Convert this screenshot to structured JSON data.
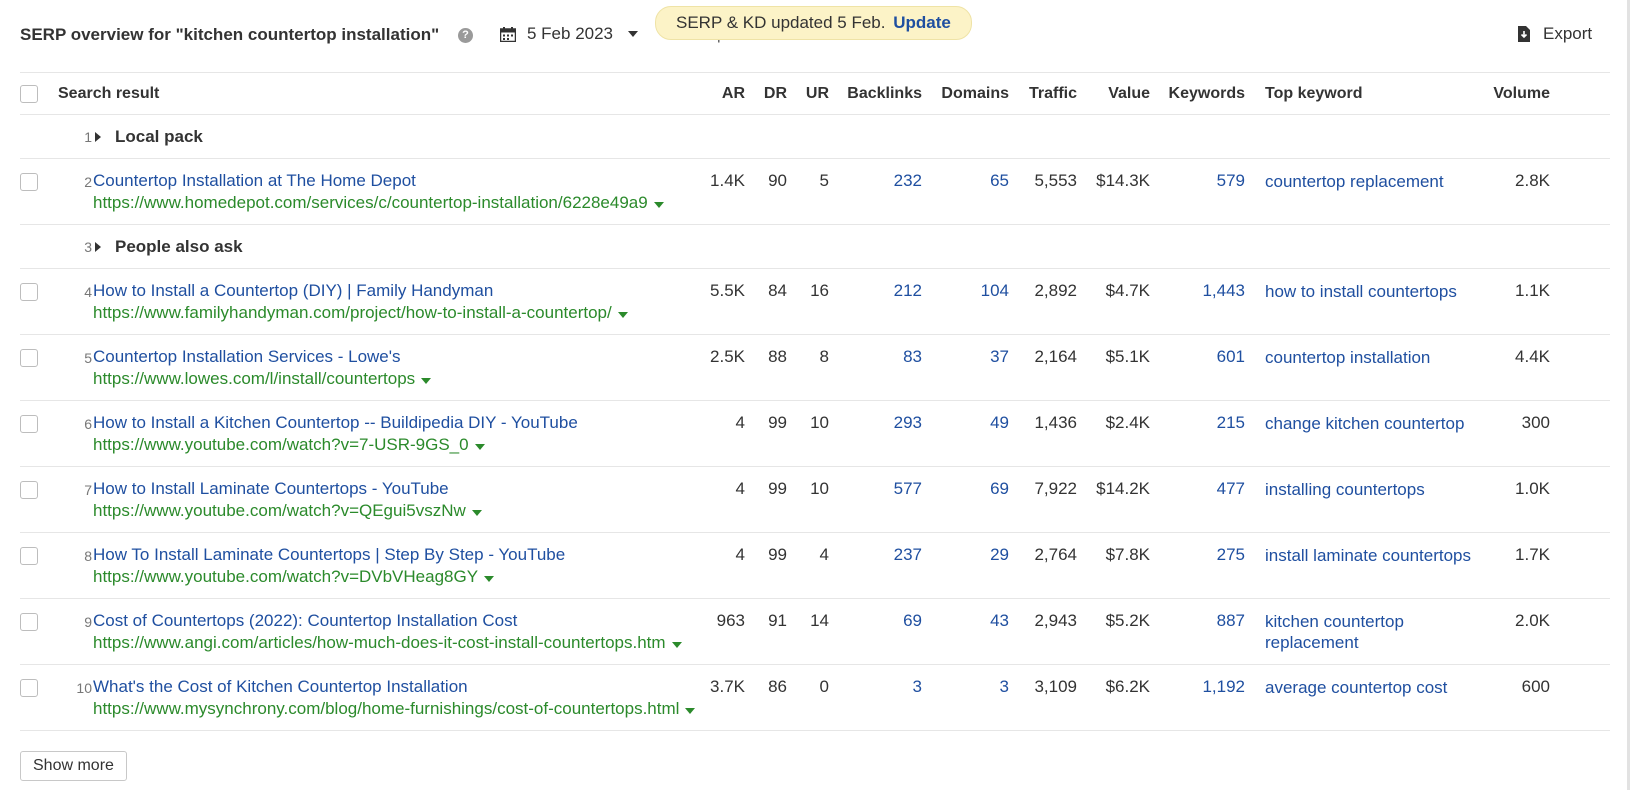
{
  "header": {
    "title": "SERP overview for \"kitchen countertop installation\"",
    "help_icon": "?",
    "date": "5 Feb 2023",
    "compare_label": "Compare with",
    "toast_text": "SERP & KD updated 5 Feb.",
    "toast_link": "Update",
    "export_label": "Export"
  },
  "columns": {
    "search_result": "Search result",
    "ar": "AR",
    "dr": "DR",
    "ur": "UR",
    "backlinks": "Backlinks",
    "domains": "Domains",
    "traffic": "Traffic",
    "value": "Value",
    "keywords": "Keywords",
    "top_keyword": "Top keyword",
    "volume": "Volume"
  },
  "features": [
    {
      "position": "1",
      "label": "Local pack"
    },
    {
      "position": "3",
      "label": "People also ask"
    }
  ],
  "results": [
    {
      "position": "2",
      "title": "Countertop Installation at The Home Depot",
      "url": "https://www.homedepot.com/services/c/countertop-installation/6228e49a9",
      "ar": "1.4K",
      "dr": "90",
      "ur": "5",
      "backlinks": "232",
      "domains": "65",
      "traffic": "5,553",
      "value": "$14.3K",
      "keywords": "579",
      "top_keyword": "countertop replacement",
      "volume": "2.8K"
    },
    {
      "position": "4",
      "title": "How to Install a Countertop (DIY) | Family Handyman",
      "url": "https://www.familyhandyman.com/project/how-to-install-a-countertop/",
      "ar": "5.5K",
      "dr": "84",
      "ur": "16",
      "backlinks": "212",
      "domains": "104",
      "traffic": "2,892",
      "value": "$4.7K",
      "keywords": "1,443",
      "top_keyword": "how to install countertops",
      "volume": "1.1K"
    },
    {
      "position": "5",
      "title": "Countertop Installation Services - Lowe's",
      "url": "https://www.lowes.com/l/install/countertops",
      "ar": "2.5K",
      "dr": "88",
      "ur": "8",
      "backlinks": "83",
      "domains": "37",
      "traffic": "2,164",
      "value": "$5.1K",
      "keywords": "601",
      "top_keyword": "countertop installation",
      "volume": "4.4K"
    },
    {
      "position": "6",
      "title": "How to Install a Kitchen Countertop -- Buildipedia DIY - YouTube",
      "url": "https://www.youtube.com/watch?v=7-USR-9GS_0",
      "ar": "4",
      "dr": "99",
      "ur": "10",
      "backlinks": "293",
      "domains": "49",
      "traffic": "1,436",
      "value": "$2.4K",
      "keywords": "215",
      "top_keyword": "change kitchen countertop",
      "volume": "300"
    },
    {
      "position": "7",
      "title": "How to Install Laminate Countertops - YouTube",
      "url": "https://www.youtube.com/watch?v=QEgui5vszNw",
      "ar": "4",
      "dr": "99",
      "ur": "10",
      "backlinks": "577",
      "domains": "69",
      "traffic": "7,922",
      "value": "$14.2K",
      "keywords": "477",
      "top_keyword": "installing countertops",
      "volume": "1.0K"
    },
    {
      "position": "8",
      "title": "How To Install Laminate Countertops | Step By Step - YouTube",
      "url": "https://www.youtube.com/watch?v=DVbVHeag8GY",
      "ar": "4",
      "dr": "99",
      "ur": "4",
      "backlinks": "237",
      "domains": "29",
      "traffic": "2,764",
      "value": "$7.8K",
      "keywords": "275",
      "top_keyword": "install laminate countertops",
      "volume": "1.7K"
    },
    {
      "position": "9",
      "title": "Cost of Countertops (2022): Countertop Installation Cost",
      "url": "https://www.angi.com/articles/how-much-does-it-cost-install-countertops.htm",
      "ar": "963",
      "dr": "91",
      "ur": "14",
      "backlinks": "69",
      "domains": "43",
      "traffic": "2,943",
      "value": "$5.2K",
      "keywords": "887",
      "top_keyword": "kitchen countertop replacement",
      "volume": "2.0K"
    },
    {
      "position": "10",
      "title": "What's the Cost of Kitchen Countertop Installation",
      "url": "https://www.mysynchrony.com/blog/home-furnishings/cost-of-countertops.html",
      "ar": "3.7K",
      "dr": "86",
      "ur": "0",
      "backlinks": "3",
      "domains": "3",
      "traffic": "3,109",
      "value": "$6.2K",
      "keywords": "1,192",
      "top_keyword": "average countertop cost",
      "volume": "600"
    }
  ],
  "show_more_label": "Show more",
  "colors": {
    "link": "#1f4fa0",
    "url": "#2b8a2b",
    "toast_bg": "#fcf3c7"
  }
}
